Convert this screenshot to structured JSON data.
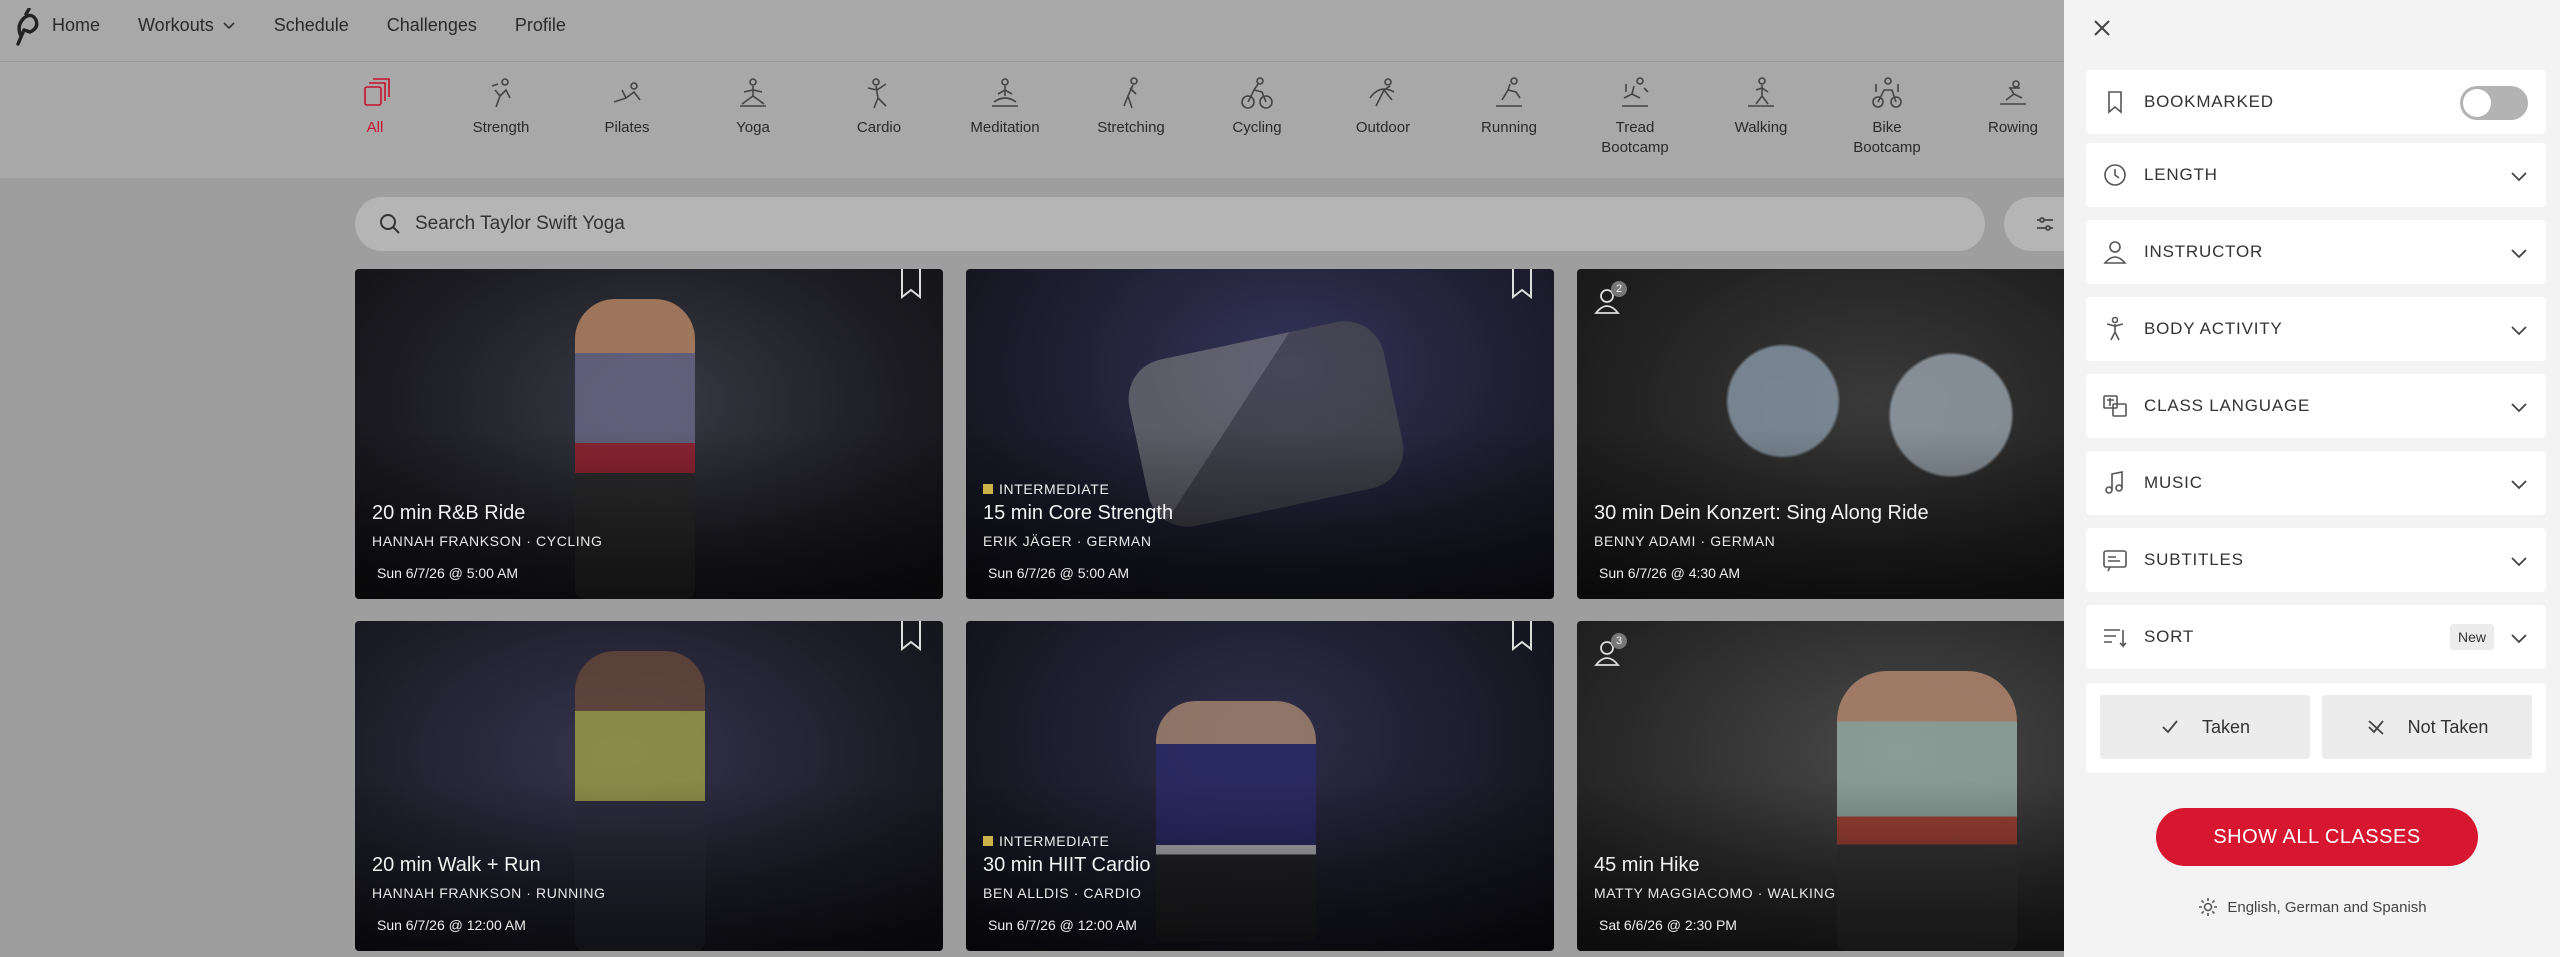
{
  "nav": {
    "links": [
      "Home",
      "Workouts",
      "Schedule",
      "Challenges",
      "Profile"
    ]
  },
  "categories": [
    {
      "label": "All",
      "icon": "stack-icon",
      "active": true
    },
    {
      "label": "Strength",
      "icon": "strength-icon"
    },
    {
      "label": "Pilates",
      "icon": "pilates-icon"
    },
    {
      "label": "Yoga",
      "icon": "yoga-icon"
    },
    {
      "label": "Cardio",
      "icon": "cardio-icon"
    },
    {
      "label": "Meditation",
      "icon": "meditation-icon"
    },
    {
      "label": "Stretching",
      "icon": "stretching-icon"
    },
    {
      "label": "Cycling",
      "icon": "cycling-icon"
    },
    {
      "label": "Outdoor",
      "icon": "outdoor-icon"
    },
    {
      "label": "Running",
      "icon": "running-icon"
    },
    {
      "label": "Tread\nBootcamp",
      "icon": "tread-bootcamp-icon"
    },
    {
      "label": "Walking",
      "icon": "walking-icon"
    },
    {
      "label": "Bike\nBootcamp",
      "icon": "bike-bootcamp-icon"
    },
    {
      "label": "Rowing",
      "icon": "rowing-icon"
    }
  ],
  "search": {
    "placeholder": "Search Taylor Swift Yoga"
  },
  "cards": [
    {
      "title": "20 min R&B Ride",
      "instructor": "HANNAH FRANKSON",
      "discipline": "CYCLING",
      "date": "Sun 6/7/26 @ 5:00 AM",
      "level": "",
      "friends": "",
      "bookmark": true
    },
    {
      "title": "15 min Core Strength",
      "instructor": "ERIK JÄGER",
      "discipline": "GERMAN",
      "date": "Sun 6/7/26 @ 5:00 AM",
      "level": "INTERMEDIATE",
      "friends": "",
      "bookmark": true
    },
    {
      "title": "30 min Dein Konzert: Sing Along Ride",
      "instructor": "BENNY ADAMI",
      "discipline": "GERMAN",
      "date": "Sun 6/7/26 @ 4:30 AM",
      "level": "",
      "friends": "2",
      "bookmark": false
    },
    {
      "title": "20 min Walk + Run",
      "instructor": "HANNAH FRANKSON",
      "discipline": "RUNNING",
      "date": "Sun 6/7/26 @ 12:00 AM",
      "level": "",
      "friends": "",
      "bookmark": true
    },
    {
      "title": "30 min HIIT Cardio",
      "instructor": "BEN ALLDIS",
      "discipline": "CARDIO",
      "date": "Sun 6/7/26 @ 12:00 AM",
      "level": "INTERMEDIATE",
      "friends": "",
      "bookmark": true
    },
    {
      "title": "45 min Hike",
      "instructor": "MATTY MAGGIACOMO",
      "discipline": "WALKING",
      "date": "Sat 6/6/26 @ 2:30 PM",
      "level": "",
      "friends": "3",
      "bookmark": false
    }
  ],
  "panel": {
    "bookmarked": "BOOKMARKED",
    "bookmarked_on": false,
    "filters": [
      "LENGTH",
      "INSTRUCTOR",
      "BODY ACTIVITY",
      "CLASS LANGUAGE",
      "MUSIC",
      "SUBTITLES",
      "SORT"
    ],
    "sort_value": "New",
    "taken": "Taken",
    "not_taken": "Not Taken",
    "show_all": "SHOW ALL CLASSES",
    "languages": "English, German and Spanish"
  },
  "colors": {
    "accent": "#d6172f",
    "overlay": "#9e9e9e",
    "panel": "#f3f3f3"
  }
}
